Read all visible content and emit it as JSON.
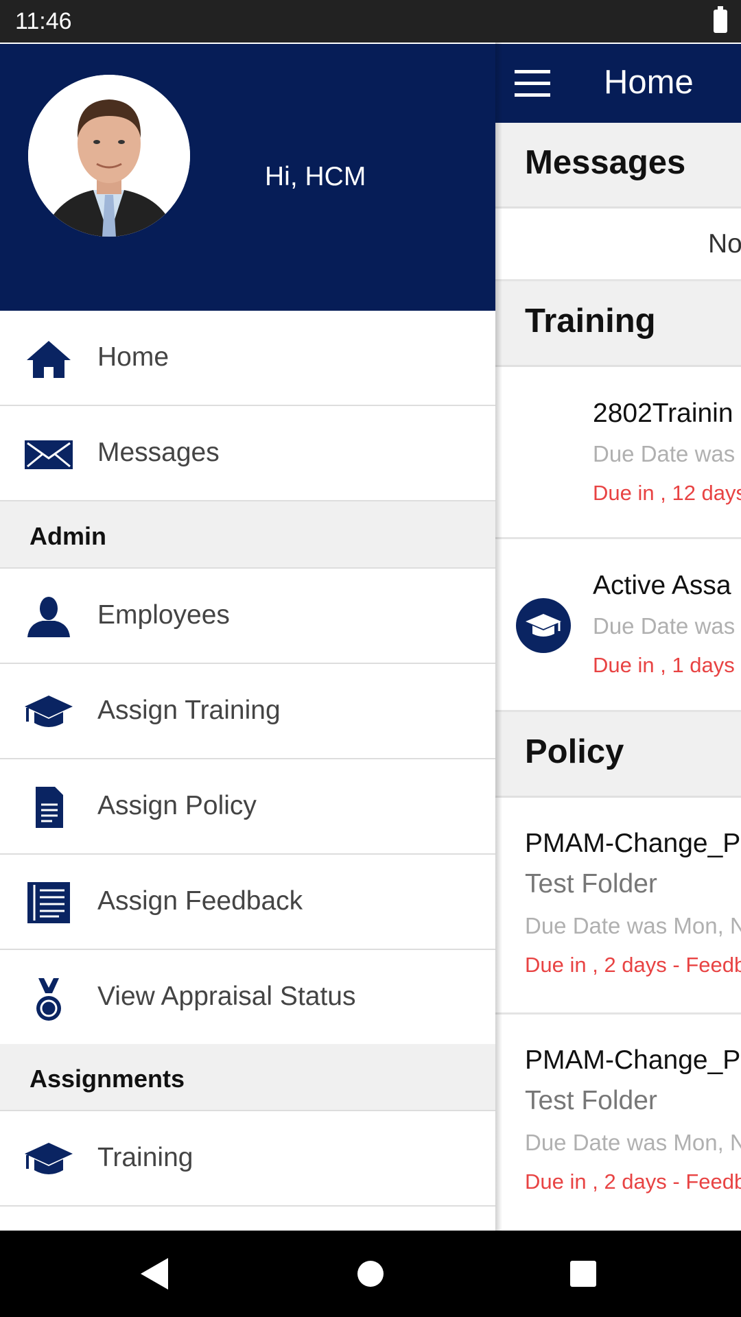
{
  "status": {
    "time": "11:46"
  },
  "toolbar": {
    "title": "Home"
  },
  "main": {
    "messages": {
      "header": "Messages",
      "empty": "No"
    },
    "training": {
      "header": "Training",
      "items": [
        {
          "title": "2802Trainin",
          "due_date": "Due Date was",
          "due_in": "Due in , 12 days"
        },
        {
          "title": "Active Assa",
          "due_date": "Due Date was",
          "due_in": "Due in , 1 days"
        }
      ]
    },
    "policy": {
      "header": "Policy",
      "items": [
        {
          "title": "PMAM-Change_P",
          "folder": "Test Folder",
          "due_date": "Due Date was Mon, N",
          "due_in": "Due in , 2 days - Feedba"
        },
        {
          "title": "PMAM-Change_P",
          "folder": "Test Folder",
          "due_date": "Due Date was Mon, N",
          "due_in": "Due in , 2 days - Feedba"
        }
      ]
    }
  },
  "drawer": {
    "greeting": "Hi, HCM",
    "items": [
      {
        "label": "Home",
        "icon": "home-icon"
      },
      {
        "label": "Messages",
        "icon": "envelope-icon"
      }
    ],
    "admin_header": "Admin",
    "admin_items": [
      {
        "label": "Employees",
        "icon": "person-icon"
      },
      {
        "label": "Assign Training",
        "icon": "graduation-cap-icon"
      },
      {
        "label": "Assign Policy",
        "icon": "document-icon"
      },
      {
        "label": "Assign Feedback",
        "icon": "list-icon"
      },
      {
        "label": "View Appraisal Status",
        "icon": "medal-icon"
      }
    ],
    "assignments_header": "Assignments",
    "assignment_items": [
      {
        "label": "Training",
        "icon": "graduation-cap-icon"
      }
    ]
  },
  "colors": {
    "primary": "#061d57",
    "due": "#e84343"
  }
}
